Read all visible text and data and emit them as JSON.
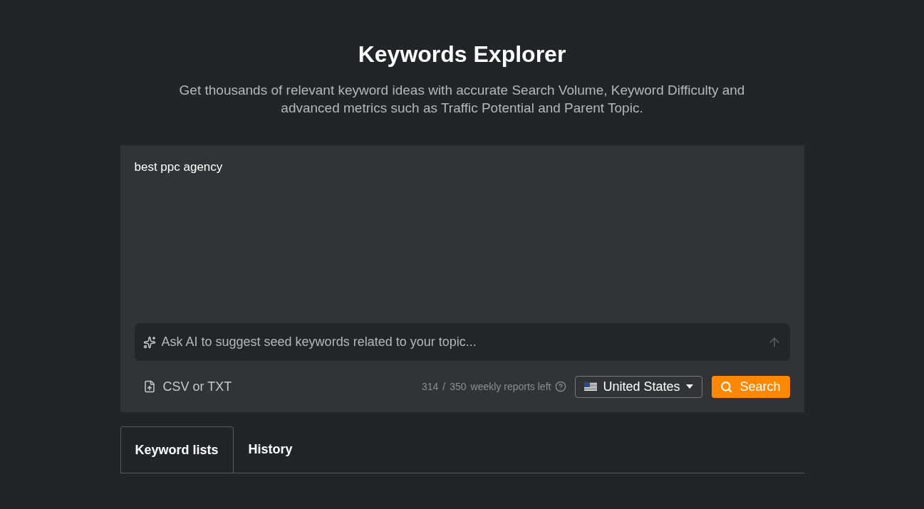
{
  "header": {
    "title": "Keywords Explorer",
    "subtitle": "Get thousands of relevant keyword ideas with accurate Search Volume, Keyword Difficulty and advanced metrics such as Traffic Potential and Parent Topic."
  },
  "keywords_input": {
    "value": "best ppc agency"
  },
  "ai_prompt": {
    "placeholder": "Ask AI to suggest seed keywords related to your topic..."
  },
  "upload": {
    "label": "CSV or TXT"
  },
  "quota": {
    "used": "314",
    "separator": "/",
    "total": "350",
    "label": "weekly reports left"
  },
  "country": {
    "label": "United States"
  },
  "search_button": {
    "label": "Search"
  },
  "tabs": [
    {
      "label": "Keyword lists",
      "selected": true
    },
    {
      "label": "History",
      "selected": false
    }
  ]
}
